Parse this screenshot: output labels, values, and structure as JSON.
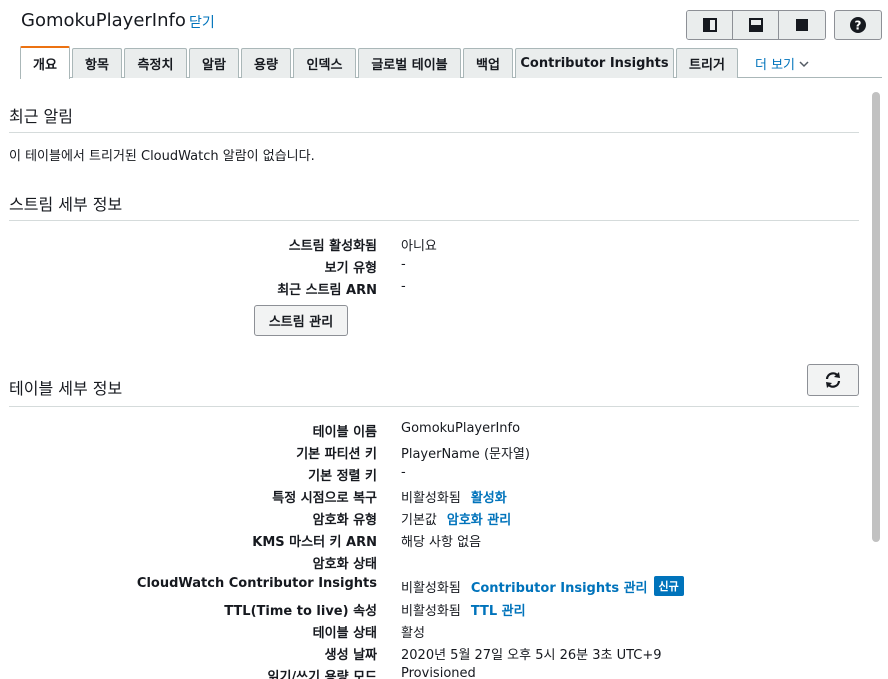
{
  "header": {
    "title": "GomokuPlayerInfo",
    "close_label": "닫기"
  },
  "view_buttons": [
    "split-vertical-icon",
    "split-horizontal-icon",
    "full-icon"
  ],
  "tabs": [
    {
      "label": "개요",
      "active": true
    },
    {
      "label": "항목"
    },
    {
      "label": "측정치"
    },
    {
      "label": "알람"
    },
    {
      "label": "용량"
    },
    {
      "label": "인덱스"
    },
    {
      "label": "글로벌 테이블"
    },
    {
      "label": "백업"
    },
    {
      "label": "Contributor Insights"
    },
    {
      "label": "트리거"
    }
  ],
  "more_label": "더 보기",
  "alarms": {
    "title": "최근 알림",
    "note": "이 테이블에서 트리거된 CloudWatch 알람이 없습니다."
  },
  "stream": {
    "title": "스트림 세부 정보",
    "rows": [
      {
        "label": "스트림 활성화됨",
        "value": "아니요"
      },
      {
        "label": "보기 유형",
        "value": "-"
      },
      {
        "label": "최근 스트림 ARN",
        "value": "-"
      }
    ],
    "manage_label": "스트림 관리"
  },
  "table": {
    "title": "테이블 세부 정보",
    "rows": [
      {
        "label": "테이블 이름",
        "value": "GomokuPlayerInfo"
      },
      {
        "label": "기본 파티션 키",
        "value": "PlayerName (문자열)"
      },
      {
        "label": "기본 정렬 키",
        "value": "-"
      },
      {
        "label": "특정 시점으로 복구",
        "value": "비활성화됨",
        "link": "활성화"
      },
      {
        "label": "암호화 유형",
        "value": "기본값",
        "link": "암호화 관리"
      },
      {
        "label": "KMS 마스터 키 ARN",
        "value": "해당 사항 없음"
      },
      {
        "label": "암호화 상태",
        "value": ""
      },
      {
        "label": "CloudWatch Contributor Insights",
        "value": "비활성화됨",
        "link": "Contributor Insights 관리",
        "badge": "신규"
      },
      {
        "label": "TTL(Time to live) 속성",
        "value": "비활성화됨",
        "link": "TTL 관리"
      },
      {
        "label": "테이블 상태",
        "value": "활성"
      },
      {
        "label": "생성 날짜",
        "value": "2020년 5월 27일 오후 5시 26분 3초 UTC+9"
      },
      {
        "label": "읽기/쓰기 용량 모드",
        "value": "Provisioned"
      }
    ]
  },
  "colors": {
    "link": "#0073bb",
    "active_tab_accent": "#ec7211"
  }
}
